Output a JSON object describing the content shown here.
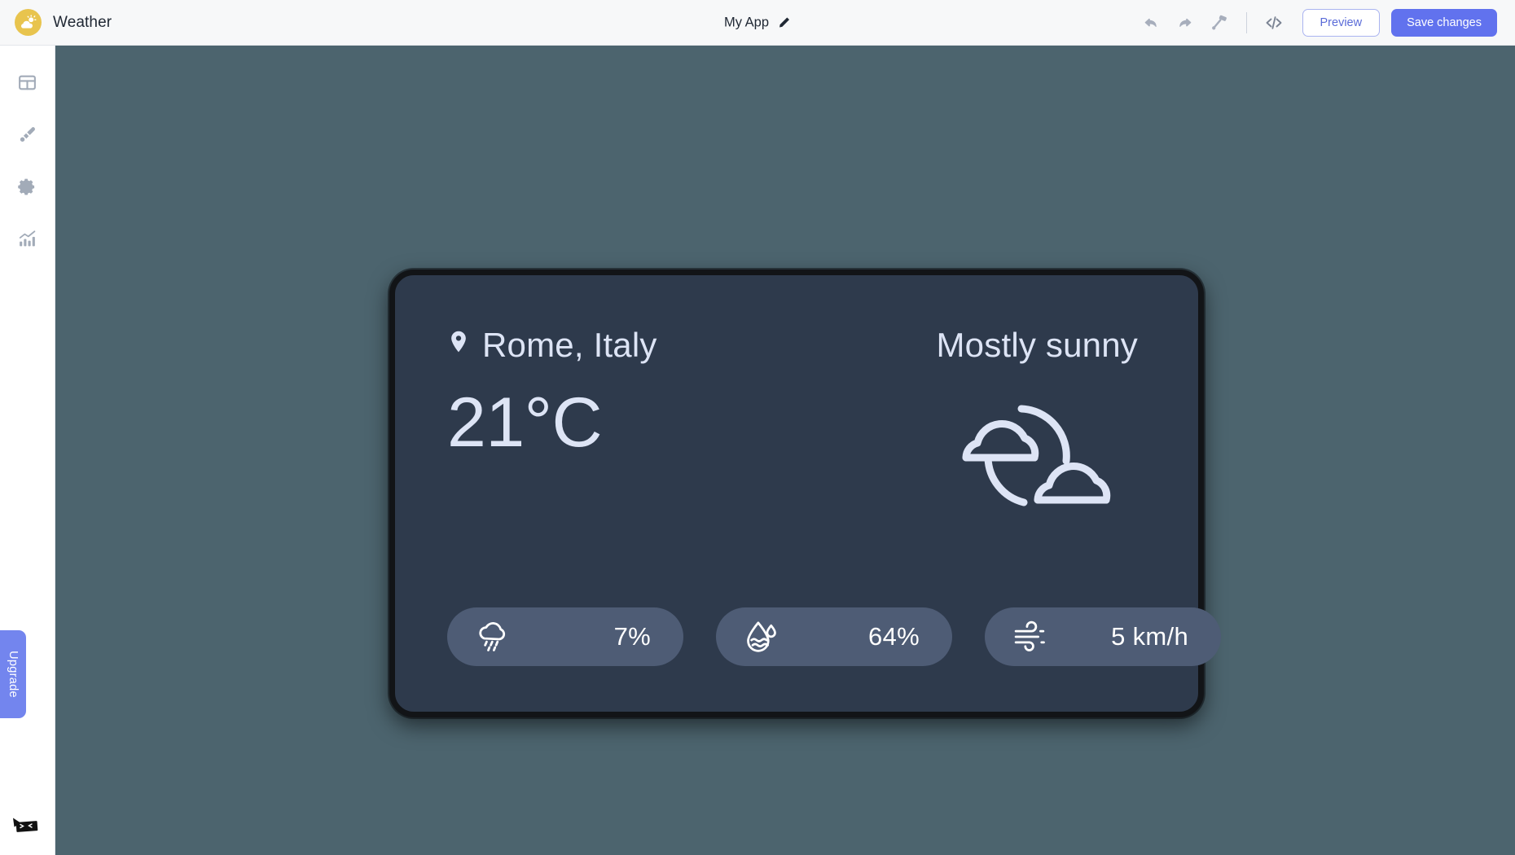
{
  "topbar": {
    "brand_name": "Weather",
    "brand_logo_icon": "sun-cloud-logo-icon",
    "app_title": "My App",
    "edit_icon": "pencil-icon",
    "undo_icon": "undo-arrow-icon",
    "redo_icon": "redo-arrow-icon",
    "theme_icon": "paint-roller-icon",
    "code_icon": "code-brackets-icon",
    "preview_label": "Preview",
    "save_label": "Save changes",
    "accent_color": "#6172ee",
    "preview_border_color": "#aab4f0",
    "bar_background": "#f7f8f9"
  },
  "sidebar": {
    "items": [
      {
        "name": "layout",
        "icon": "layout-grid-icon"
      },
      {
        "name": "theme",
        "icon": "paint-brush-icon"
      },
      {
        "name": "settings",
        "icon": "gear-icon"
      },
      {
        "name": "analytics",
        "icon": "bar-chart-trend-icon"
      }
    ],
    "upgrade_label": "Upgrade",
    "upgrade_color": "#7385ee",
    "helper_icon": "chat-bot-face-icon"
  },
  "canvas": {
    "background_color": "#4c646e"
  },
  "weather_card": {
    "background_color": "#2e3a4c",
    "border_color": "#121417",
    "text_color": "#dde4f5",
    "location": "Rome, Italy",
    "location_icon": "map-pin-icon",
    "temperature": "21°C",
    "condition": "Mostly sunny",
    "condition_icon": "sun-behind-clouds-icon",
    "pill_color": "#4e5c75",
    "stats": [
      {
        "name": "precipitation",
        "icon": "rain-cloud-icon",
        "value": "7%"
      },
      {
        "name": "humidity",
        "icon": "humidity-droplet-icon",
        "value": "64%"
      },
      {
        "name": "wind",
        "icon": "wind-icon",
        "value": "5 km/h"
      }
    ]
  }
}
